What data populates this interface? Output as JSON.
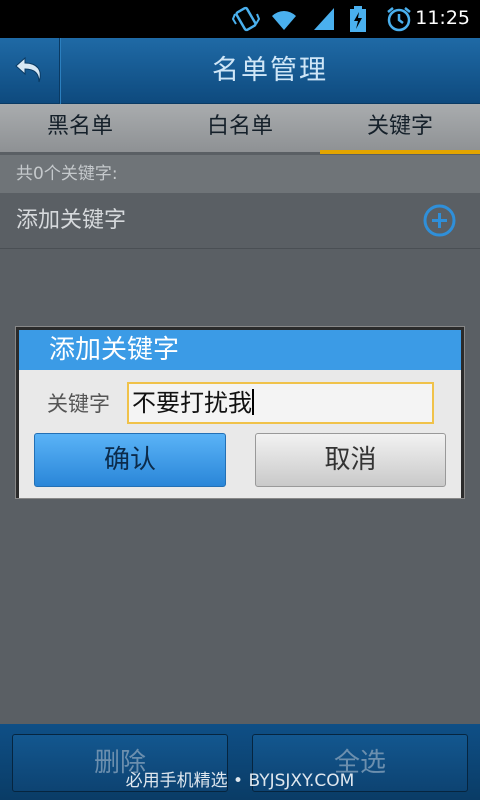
{
  "status_bar": {
    "time": "11:25",
    "icons": [
      "vibrate-icon",
      "wifi-icon",
      "signal-icon",
      "battery-charging-icon",
      "alarm-icon"
    ]
  },
  "header": {
    "title": "名单管理",
    "back_icon": "back-arrow-icon"
  },
  "tabs": [
    {
      "label": "黑名单",
      "active": false
    },
    {
      "label": "白名单",
      "active": false
    },
    {
      "label": "关键字",
      "active": true
    }
  ],
  "keyword_list": {
    "count_text": "共0个关键字:",
    "add_label": "添加关键字",
    "add_icon": "plus-circle-icon"
  },
  "dialog": {
    "title": "添加关键字",
    "field_label": "关键字",
    "field_value": "不要打扰我",
    "confirm_label": "确认",
    "cancel_label": "取消"
  },
  "bottom_bar": {
    "delete_label": "删除",
    "select_all_label": "全选"
  },
  "watermark": "必用手机精选 • BYJSJXY.COM",
  "colors": {
    "accent": "#3b9be6",
    "tab_indicator": "#e3a500",
    "titlebar": "#1f6aa6"
  }
}
